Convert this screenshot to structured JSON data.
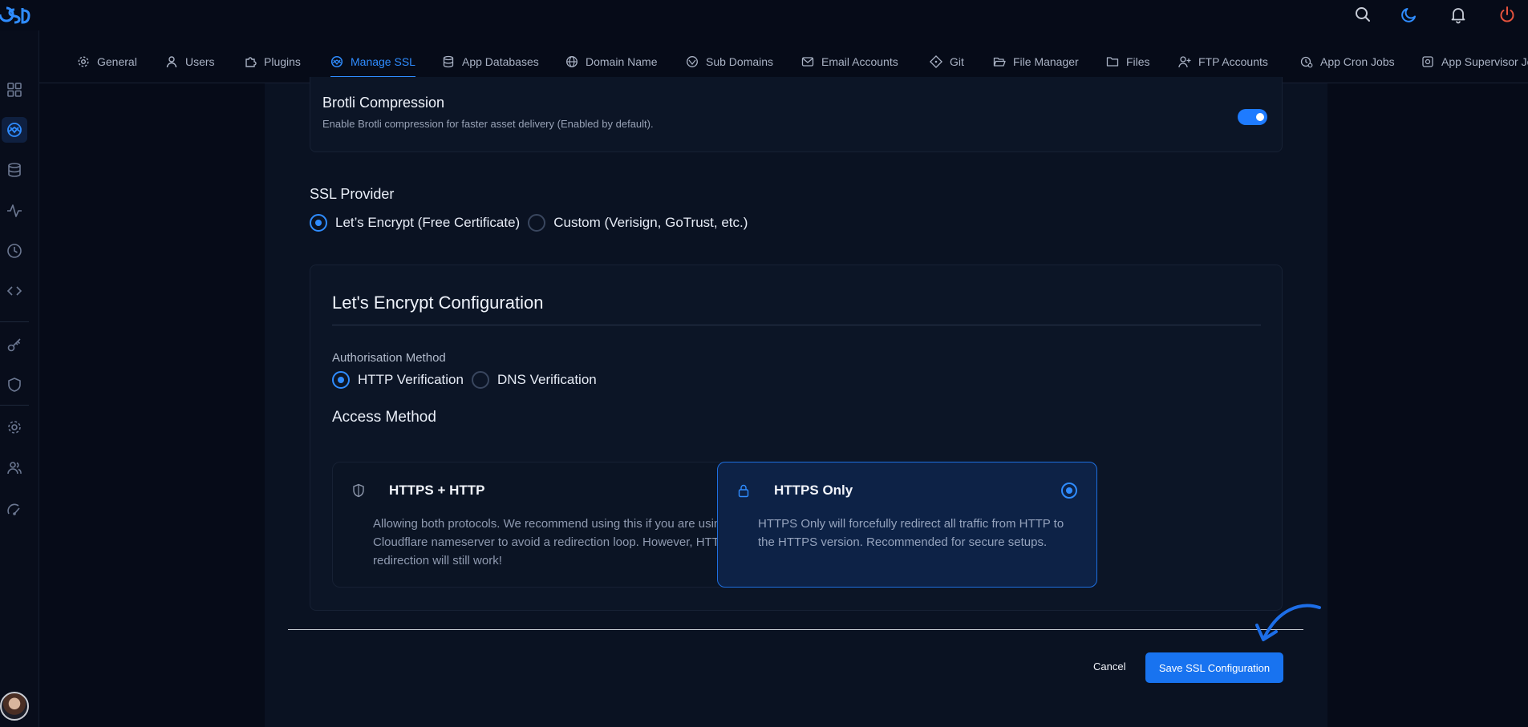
{
  "nav_tabs": [
    {
      "label": "General",
      "icon": "gear-icon"
    },
    {
      "label": "Users",
      "icon": "user-icon"
    },
    {
      "label": "Plugins",
      "icon": "puzzle-icon"
    },
    {
      "label": "Manage SSL",
      "icon": "ssl-icon",
      "active": true
    },
    {
      "label": "App Databases",
      "icon": "database-icon"
    },
    {
      "label": "Domain Name",
      "icon": "globe-icon"
    },
    {
      "label": "Sub Domains",
      "icon": "subdomain-icon"
    },
    {
      "label": "Email Accounts",
      "icon": "mail-icon"
    },
    {
      "label": "Git",
      "icon": "git-icon"
    },
    {
      "label": "File Manager",
      "icon": "folder-open-icon"
    },
    {
      "label": "Files",
      "icon": "folder-icon"
    },
    {
      "label": "FTP Accounts",
      "icon": "user-plus-icon"
    },
    {
      "label": "App Cron Jobs",
      "icon": "cron-icon"
    },
    {
      "label": "App Supervisor Jo",
      "icon": "supervisor-icon"
    }
  ],
  "brotli": {
    "title": "Brotli Compression",
    "description": "Enable Brotli compression for faster asset delivery (Enabled by default).",
    "enabled": true
  },
  "ssl_provider": {
    "label": "SSL Provider",
    "options": [
      {
        "label": "Let’s Encrypt (Free Certificate)",
        "selected": true
      },
      {
        "label": "Custom (Verisign, GoTrust, etc.)",
        "selected": false
      }
    ]
  },
  "letsencrypt": {
    "title": "Let's Encrypt Configuration",
    "auth_label": "Authorisation Method",
    "auth_options": [
      {
        "label": "HTTP Verification",
        "selected": true
      },
      {
        "label": "DNS Verification",
        "selected": false
      }
    ],
    "access_label": "Access Method",
    "access_options": [
      {
        "title": "HTTPS + HTTP",
        "icon": "shield-icon",
        "description": "Allowing both protocols. We recommend using this if you are using a Cloudflare nameserver to avoid a redirection loop. However, HTTPS redirection will still work!",
        "selected": false
      },
      {
        "title": "HTTPS Only",
        "icon": "lock-icon",
        "description": "HTTPS Only will forcefully redirect all traffic from HTTP to the HTTPS version. Recommended for secure setups.",
        "selected": true
      }
    ]
  },
  "footer": {
    "cancel_label": "Cancel",
    "save_label": "Save SSL Configuration"
  },
  "colors": {
    "accent": "#2f8cff",
    "background": "#060b18",
    "panel": "#0a1222",
    "power": "#e5533d"
  }
}
